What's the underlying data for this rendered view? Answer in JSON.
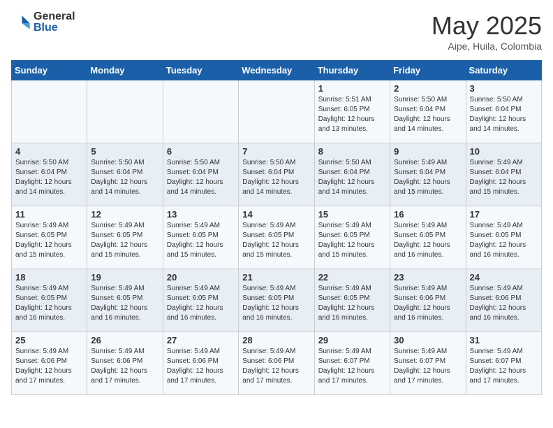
{
  "logo": {
    "general": "General",
    "blue": "Blue"
  },
  "title": "May 2025",
  "subtitle": "Aipe, Huila, Colombia",
  "weekdays": [
    "Sunday",
    "Monday",
    "Tuesday",
    "Wednesday",
    "Thursday",
    "Friday",
    "Saturday"
  ],
  "weeks": [
    [
      {
        "day": "",
        "info": ""
      },
      {
        "day": "",
        "info": ""
      },
      {
        "day": "",
        "info": ""
      },
      {
        "day": "",
        "info": ""
      },
      {
        "day": "1",
        "info": "Sunrise: 5:51 AM\nSunset: 6:05 PM\nDaylight: 12 hours\nand 13 minutes."
      },
      {
        "day": "2",
        "info": "Sunrise: 5:50 AM\nSunset: 6:04 PM\nDaylight: 12 hours\nand 14 minutes."
      },
      {
        "day": "3",
        "info": "Sunrise: 5:50 AM\nSunset: 6:04 PM\nDaylight: 12 hours\nand 14 minutes."
      }
    ],
    [
      {
        "day": "4",
        "info": "Sunrise: 5:50 AM\nSunset: 6:04 PM\nDaylight: 12 hours\nand 14 minutes."
      },
      {
        "day": "5",
        "info": "Sunrise: 5:50 AM\nSunset: 6:04 PM\nDaylight: 12 hours\nand 14 minutes."
      },
      {
        "day": "6",
        "info": "Sunrise: 5:50 AM\nSunset: 6:04 PM\nDaylight: 12 hours\nand 14 minutes."
      },
      {
        "day": "7",
        "info": "Sunrise: 5:50 AM\nSunset: 6:04 PM\nDaylight: 12 hours\nand 14 minutes."
      },
      {
        "day": "8",
        "info": "Sunrise: 5:50 AM\nSunset: 6:04 PM\nDaylight: 12 hours\nand 14 minutes."
      },
      {
        "day": "9",
        "info": "Sunrise: 5:49 AM\nSunset: 6:04 PM\nDaylight: 12 hours\nand 15 minutes."
      },
      {
        "day": "10",
        "info": "Sunrise: 5:49 AM\nSunset: 6:04 PM\nDaylight: 12 hours\nand 15 minutes."
      }
    ],
    [
      {
        "day": "11",
        "info": "Sunrise: 5:49 AM\nSunset: 6:05 PM\nDaylight: 12 hours\nand 15 minutes."
      },
      {
        "day": "12",
        "info": "Sunrise: 5:49 AM\nSunset: 6:05 PM\nDaylight: 12 hours\nand 15 minutes."
      },
      {
        "day": "13",
        "info": "Sunrise: 5:49 AM\nSunset: 6:05 PM\nDaylight: 12 hours\nand 15 minutes."
      },
      {
        "day": "14",
        "info": "Sunrise: 5:49 AM\nSunset: 6:05 PM\nDaylight: 12 hours\nand 15 minutes."
      },
      {
        "day": "15",
        "info": "Sunrise: 5:49 AM\nSunset: 6:05 PM\nDaylight: 12 hours\nand 15 minutes."
      },
      {
        "day": "16",
        "info": "Sunrise: 5:49 AM\nSunset: 6:05 PM\nDaylight: 12 hours\nand 16 minutes."
      },
      {
        "day": "17",
        "info": "Sunrise: 5:49 AM\nSunset: 6:05 PM\nDaylight: 12 hours\nand 16 minutes."
      }
    ],
    [
      {
        "day": "18",
        "info": "Sunrise: 5:49 AM\nSunset: 6:05 PM\nDaylight: 12 hours\nand 16 minutes."
      },
      {
        "day": "19",
        "info": "Sunrise: 5:49 AM\nSunset: 6:05 PM\nDaylight: 12 hours\nand 16 minutes."
      },
      {
        "day": "20",
        "info": "Sunrise: 5:49 AM\nSunset: 6:05 PM\nDaylight: 12 hours\nand 16 minutes."
      },
      {
        "day": "21",
        "info": "Sunrise: 5:49 AM\nSunset: 6:05 PM\nDaylight: 12 hours\nand 16 minutes."
      },
      {
        "day": "22",
        "info": "Sunrise: 5:49 AM\nSunset: 6:05 PM\nDaylight: 12 hours\nand 16 minutes."
      },
      {
        "day": "23",
        "info": "Sunrise: 5:49 AM\nSunset: 6:06 PM\nDaylight: 12 hours\nand 16 minutes."
      },
      {
        "day": "24",
        "info": "Sunrise: 5:49 AM\nSunset: 6:06 PM\nDaylight: 12 hours\nand 16 minutes."
      }
    ],
    [
      {
        "day": "25",
        "info": "Sunrise: 5:49 AM\nSunset: 6:06 PM\nDaylight: 12 hours\nand 17 minutes."
      },
      {
        "day": "26",
        "info": "Sunrise: 5:49 AM\nSunset: 6:06 PM\nDaylight: 12 hours\nand 17 minutes."
      },
      {
        "day": "27",
        "info": "Sunrise: 5:49 AM\nSunset: 6:06 PM\nDaylight: 12 hours\nand 17 minutes."
      },
      {
        "day": "28",
        "info": "Sunrise: 5:49 AM\nSunset: 6:06 PM\nDaylight: 12 hours\nand 17 minutes."
      },
      {
        "day": "29",
        "info": "Sunrise: 5:49 AM\nSunset: 6:07 PM\nDaylight: 12 hours\nand 17 minutes."
      },
      {
        "day": "30",
        "info": "Sunrise: 5:49 AM\nSunset: 6:07 PM\nDaylight: 12 hours\nand 17 minutes."
      },
      {
        "day": "31",
        "info": "Sunrise: 5:49 AM\nSunset: 6:07 PM\nDaylight: 12 hours\nand 17 minutes."
      }
    ]
  ]
}
